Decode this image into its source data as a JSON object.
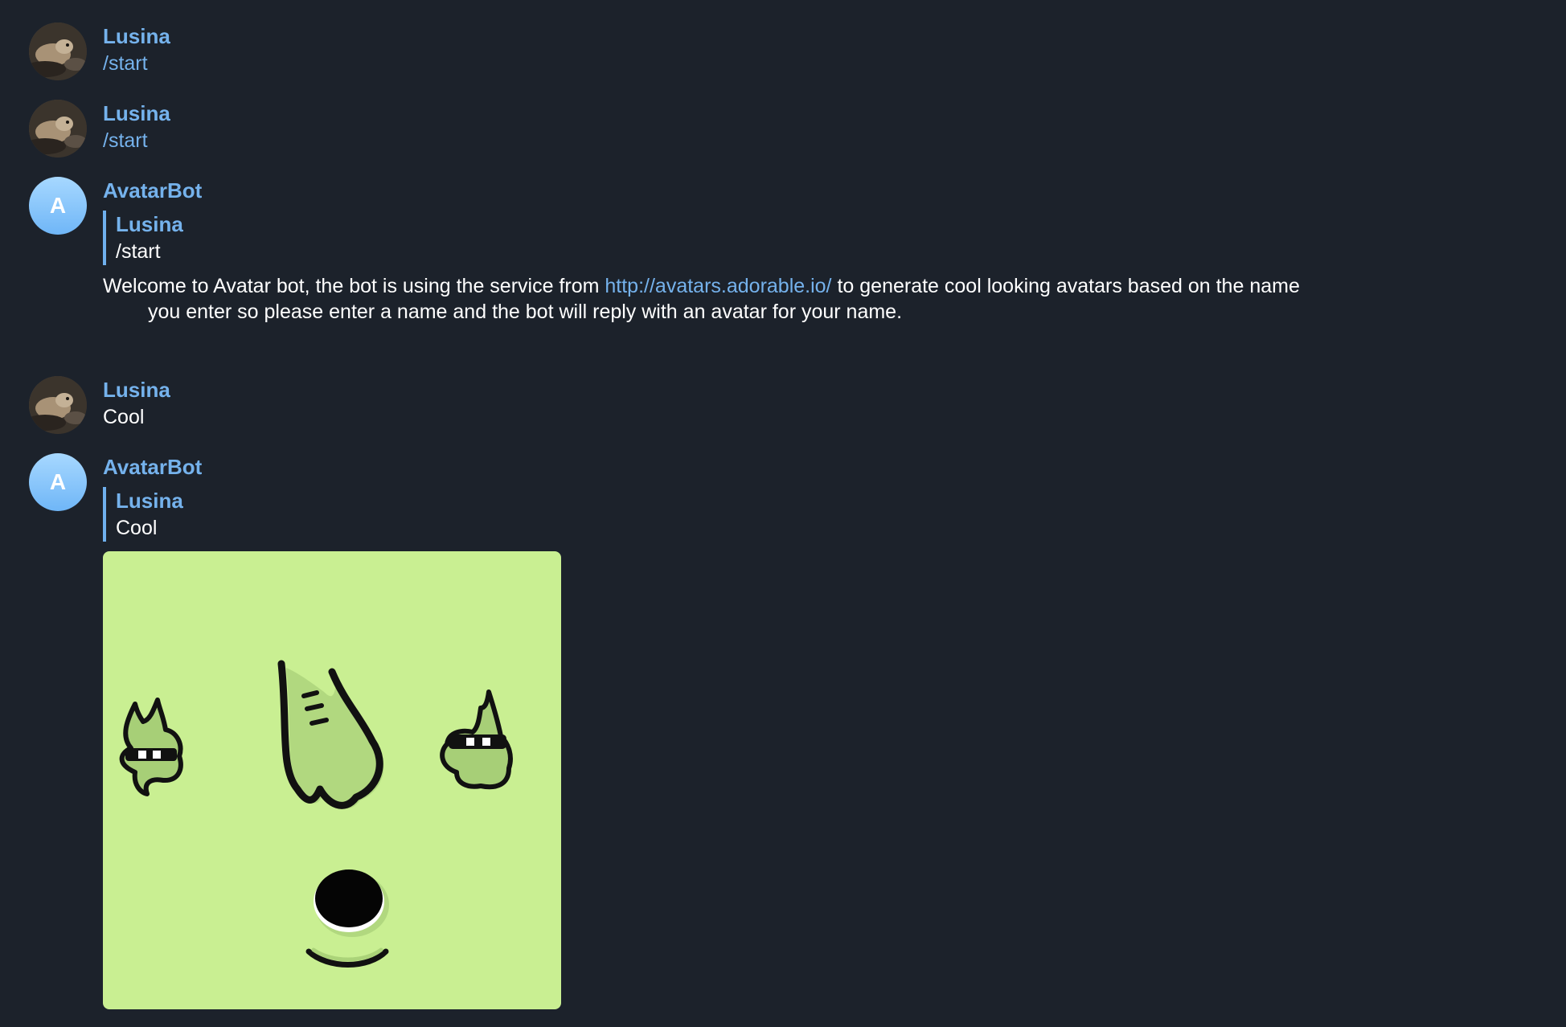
{
  "messages": [
    {
      "sender": "Lusina",
      "text": "/start"
    },
    {
      "sender": "Lusina",
      "text": "/start"
    },
    {
      "sender": "AvatarBot",
      "avatar_letter": "A",
      "reply_to": {
        "sender": "Lusina",
        "text": "/start"
      },
      "text_before_link": "Welcome to Avatar bot, the bot is using the service from ",
      "link": "http://avatars.adorable.io/",
      "text_after_link": " to generate cool looking avatars based on the name you enter so please enter a name and the bot will reply with an avatar for your name."
    },
    {
      "sender": "Lusina",
      "text": "Cool"
    },
    {
      "sender": "AvatarBot",
      "avatar_letter": "A",
      "reply_to": {
        "sender": "Lusina",
        "text": "Cool"
      },
      "image": "generated-avatar-face"
    }
  ],
  "colors": {
    "background": "#1c222b",
    "sender_name": "#75b2ec",
    "link": "#75b2ec",
    "text": "#ffffff",
    "avatar_image_bg": "#c9ef92"
  }
}
